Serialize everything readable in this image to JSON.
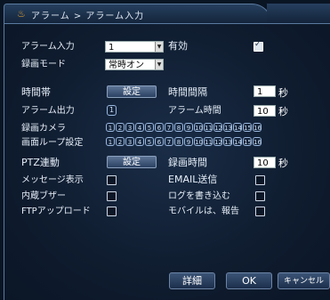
{
  "window": {
    "breadcrumb": "アラーム > アラーム入力",
    "title_icon": "fire-icon"
  },
  "alarm_input": {
    "label": "アラーム入力",
    "value": "1",
    "enabled_label": "有効",
    "enabled": true
  },
  "record_mode": {
    "label": "録画モード",
    "value": "常時オン"
  },
  "schedule": {
    "label": "時間帯",
    "button": "設定"
  },
  "interval": {
    "label": "時間間隔",
    "value": "1",
    "unit": "秒"
  },
  "alarm_output": {
    "label": "アラーム出力",
    "value": "1"
  },
  "alarm_time": {
    "label": "アラーム時間",
    "value": "10",
    "unit": "秒"
  },
  "record_camera": {
    "label": "録画カメラ",
    "channels": [
      "1",
      "2",
      "3",
      "4",
      "5",
      "6",
      "7",
      "8",
      "9",
      "10",
      "11",
      "12",
      "13",
      "14",
      "15",
      "16"
    ]
  },
  "screen_loop": {
    "label": "画面ループ設定",
    "channels": [
      "1",
      "2",
      "3",
      "4",
      "5",
      "6",
      "7",
      "8",
      "9",
      "10",
      "11",
      "12",
      "13",
      "14",
      "15",
      "16"
    ]
  },
  "ptz": {
    "label": "PTZ連動",
    "button": "設定"
  },
  "record_delay": {
    "label": "録画時間",
    "value": "10",
    "unit": "秒"
  },
  "show_message": {
    "label": "メッセージ表示"
  },
  "send_email": {
    "label": "EMAIL送信"
  },
  "buzzer": {
    "label": "内蔵ブザー"
  },
  "write_log": {
    "label": "ログを書き込む"
  },
  "ftp_upload": {
    "label": "FTPアップロード"
  },
  "mobile_report": {
    "label": "モバイルは、報告"
  },
  "footer": {
    "advanced": "詳細",
    "ok": "OK",
    "cancel": "キャンセル"
  }
}
